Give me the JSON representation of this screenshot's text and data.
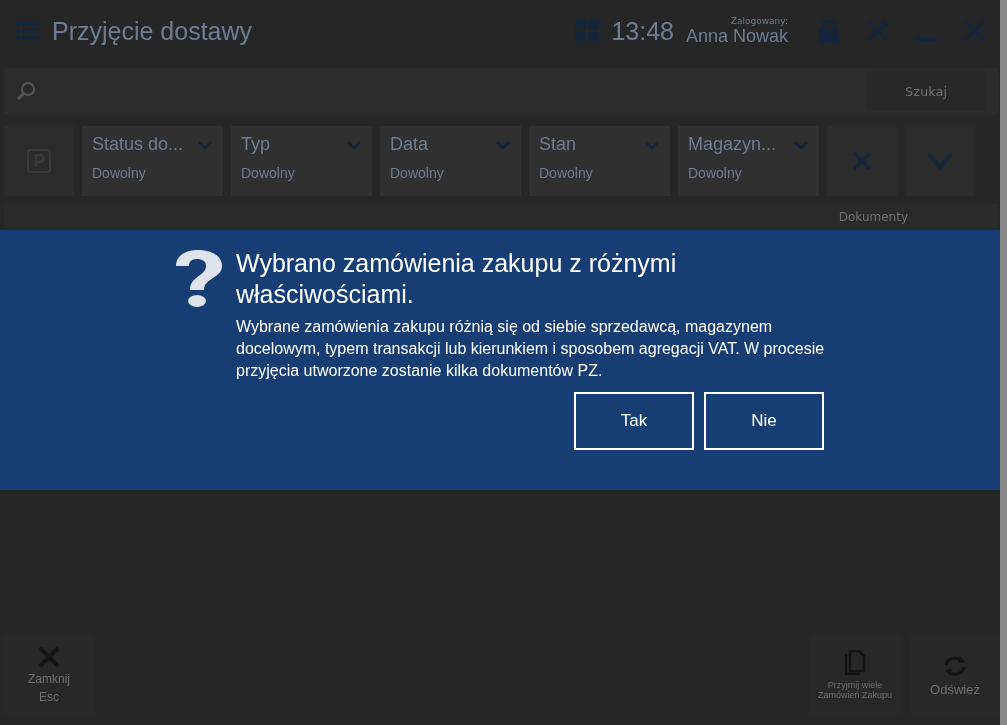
{
  "header": {
    "title": "Przyjęcie dostawy",
    "time": "13:48",
    "user_label": "Zalogowany:",
    "user": "Anna Nowak"
  },
  "search": {
    "button": "Szukaj"
  },
  "filters": [
    {
      "label": "Status do...",
      "value": "Dowolny"
    },
    {
      "label": "Typ",
      "value": "Dowolny"
    },
    {
      "label": "Data",
      "value": "Dowolny"
    },
    {
      "label": "Stan",
      "value": "Dowolny"
    },
    {
      "label": "Magazyn...",
      "value": "Dowolny"
    }
  ],
  "table": {
    "columns": [
      "Dokumenty"
    ]
  },
  "dialog": {
    "title": "Wybrano zamówienia zakupu z różnymi właściwościami.",
    "message": "Wybrane zamówienia zakupu różnią się od siebie sprzedawcą, magazynem docelowym, typem transakcji lub kierunkiem i sposobem agregacji VAT. W procesie przyjęcia utworzone zostanie kilka dokumentów PZ.",
    "buttons": [
      "Tak",
      "Nie"
    ]
  },
  "footer": {
    "close": {
      "label": "Zamknij",
      "shortcut": "Esc"
    },
    "actions": [
      {
        "kind": "copy",
        "label": "Przyjmij wiele Zamówień Zakupu"
      },
      {
        "kind": "refresh",
        "label": "Odśwież"
      }
    ]
  }
}
